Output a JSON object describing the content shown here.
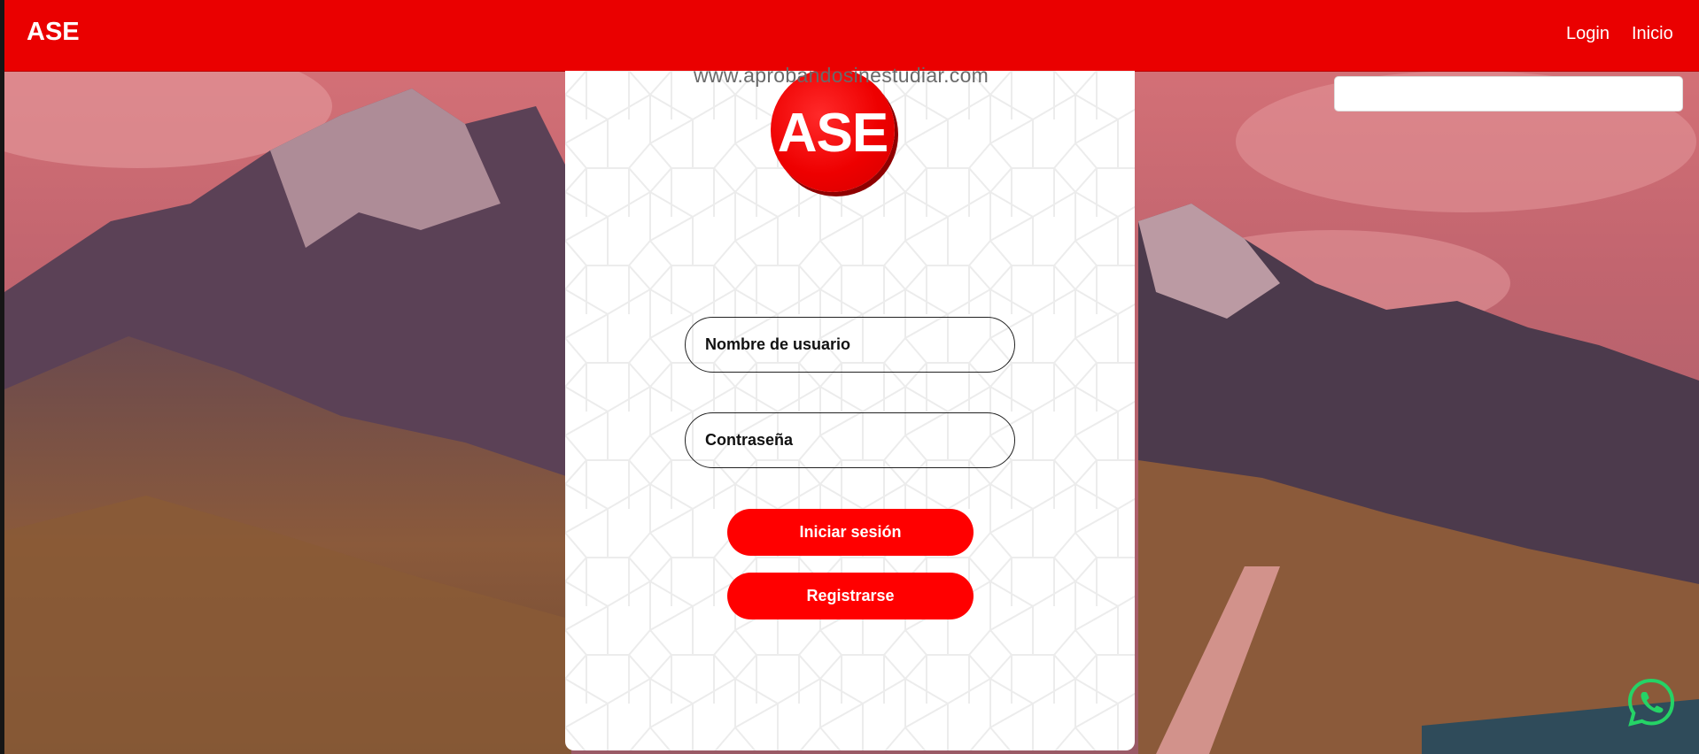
{
  "navbar": {
    "brand": "ASE",
    "links": [
      "Login",
      "Inicio"
    ],
    "search_value": ""
  },
  "watermark": "www.aprobandosinestudiar.com",
  "login_card": {
    "logo_text": "ASE",
    "username_placeholder": "Nombre de usuario",
    "password_placeholder": "Contraseña",
    "login_button": "Iniciar sesión",
    "register_button": "Registrarse"
  },
  "whatsapp_icon": "whatsapp-icon",
  "colors": {
    "brand_red": "#ea0000",
    "button_red": "#ff0000",
    "whatsapp_green": "#25d366"
  }
}
